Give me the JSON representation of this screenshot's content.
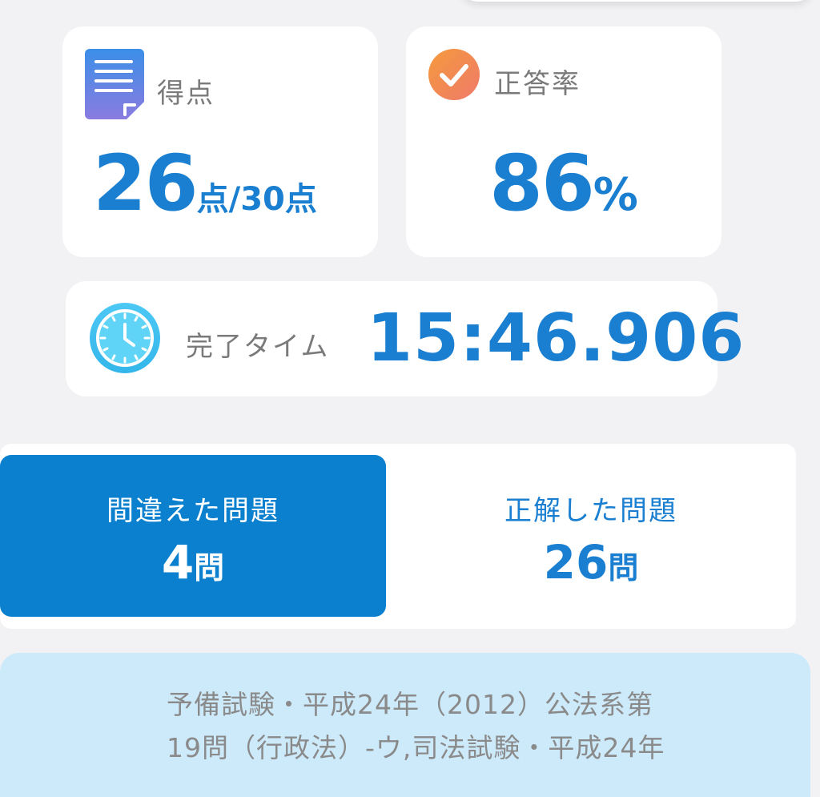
{
  "score": {
    "label": "得点",
    "value": "26",
    "unit": "点/30点",
    "icon": "document-icon"
  },
  "accuracy": {
    "label": "正答率",
    "value": "86",
    "unit": "%",
    "icon": "check-icon"
  },
  "time": {
    "label": "完了タイム",
    "value": "15:46.906",
    "icon": "clock-icon"
  },
  "tabs": {
    "wrong": {
      "title": "間違えた問題",
      "count": "4",
      "unit": "問",
      "selected": true
    },
    "correct": {
      "title": "正解した問題",
      "count": "26",
      "unit": "問",
      "selected": false
    }
  },
  "notice": {
    "lines": [
      "予備試験・平成24年（2012）公法系第",
      "19問（行政法）-ウ,司法試験・平成24年"
    ]
  },
  "colors": {
    "accent": "#1a7fd0",
    "tab_active": "#0a80cf",
    "notice_bg": "#cdeafb",
    "background": "#f2f2f4"
  }
}
